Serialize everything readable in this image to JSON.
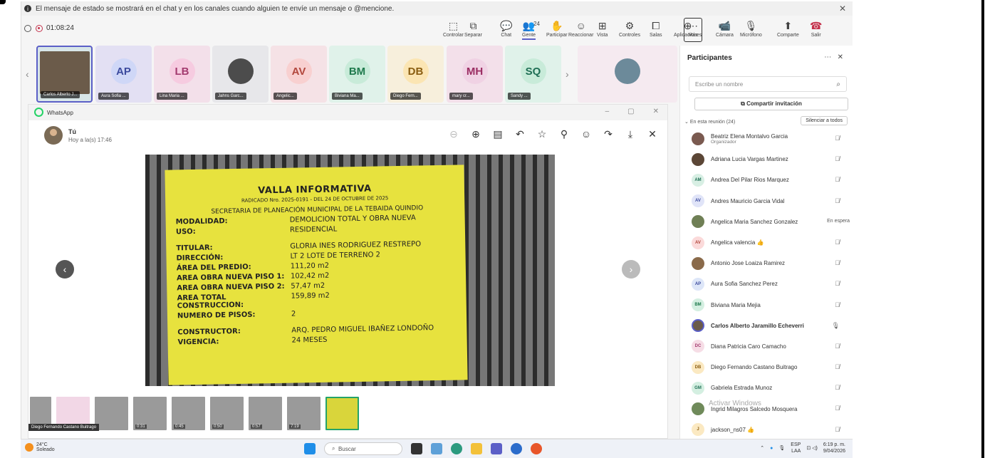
{
  "notice": {
    "text": "El mensaje de estado se mostrará en el chat y en los canales cuando alguien te envíe un mensaje o @mencione.",
    "close": "✕"
  },
  "call": {
    "timer": "01:08:24"
  },
  "toolbar": {
    "items": [
      {
        "label": "Controlar",
        "icon": "⬚"
      },
      {
        "label": "Separar",
        "icon": "⧉"
      },
      {
        "label": "Chat",
        "icon": "💬"
      },
      {
        "label": "Gente",
        "icon": "👥",
        "count": "24"
      },
      {
        "label": "Participar",
        "icon": "✋"
      },
      {
        "label": "Reaccionar",
        "icon": "☺"
      },
      {
        "label": "Vista",
        "icon": "⊞"
      },
      {
        "label": "Controles",
        "icon": "⚙"
      },
      {
        "label": "Salas",
        "icon": "⧠"
      },
      {
        "label": "Aplicaciones",
        "icon": "⊕"
      },
      {
        "label": "Más",
        "icon": "⋯"
      },
      {
        "label": "Cámara",
        "icon": "📹"
      },
      {
        "label": "Micrófono",
        "icon": "🎙"
      },
      {
        "label": "Comparte",
        "icon": "⬆"
      },
      {
        "label": "Salir",
        "icon": "☎"
      }
    ]
  },
  "strip": {
    "tiles": [
      {
        "initials": "",
        "name": "Carlos Alberto J...",
        "bg": "#d8e6e8",
        "avbg": "#6b5b4a"
      },
      {
        "initials": "AP",
        "name": "Aura Sofia ...",
        "bg": "#e3e0f3",
        "avbg": "#cfd7f7",
        "fg": "#3b4a9e"
      },
      {
        "initials": "LB",
        "name": "Lina Maria ...",
        "bg": "#f3e0ea",
        "avbg": "#f6cbe0",
        "fg": "#a33a6f"
      },
      {
        "initials": "",
        "name": "Jahns Garc...",
        "bg": "#e7e7ea",
        "avbg": "#4c4c4c"
      },
      {
        "initials": "AV",
        "name": "Angelic...",
        "bg": "#f5e2e6",
        "avbg": "#f8d0d0",
        "fg": "#b2473c"
      },
      {
        "initials": "BM",
        "name": "Biviana Ma...",
        "bg": "#e0f2ea",
        "avbg": "#c8ebd9",
        "fg": "#1f7a4d"
      },
      {
        "initials": "DB",
        "name": "Diego Fern...",
        "bg": "#f7efdc",
        "avbg": "#fbe5b3",
        "fg": "#8a5d10"
      },
      {
        "initials": "MH",
        "name": "mary cr...",
        "bg": "#f3e0ea",
        "avbg": "#f0d2e4",
        "fg": "#9b2e63"
      },
      {
        "initials": "SQ",
        "name": "Sandy ...",
        "bg": "#e0f2ea",
        "avbg": "#c8ebd9",
        "fg": "#1f6f55"
      },
      {
        "initials": "",
        "name": "",
        "bg": "#f5eaf0",
        "avbg": "#6c8a9a"
      }
    ]
  },
  "whatsapp": {
    "title": "WhatsApp",
    "sender": "Tú",
    "time": "Hoy a la(s) 17:46",
    "tools": [
      "⊖",
      "⊕",
      "▤",
      "↶",
      "☆",
      "⚲",
      "☺",
      "↷",
      "⤓",
      "✕"
    ],
    "sign": {
      "title": "VALLA INFORMATIVA",
      "radicado": "RADICADO Nro. 2025-0191 - DEL 24 DE OCTUBRE DE 2025",
      "secretaria": "SECRETARIA DE PLANEACIÓN MUNICIPAL DE LA TEBAIDA QUINDIO",
      "rows": [
        {
          "k": "MODALIDAD:",
          "v": "DEMOLICION TOTAL Y OBRA NUEVA"
        },
        {
          "k": "USO:",
          "v": "RESIDENCIAL"
        },
        {
          "k": "TITULAR:",
          "v": "GLORIA INES RODRIGUEZ RESTREPO"
        },
        {
          "k": "DIRECCIÓN:",
          "v": "LT 2 LOTE DE TERRENO 2"
        },
        {
          "k": "ÁREA DEL PREDIO:",
          "v": "111,20 m2"
        },
        {
          "k": "AREA OBRA NUEVA PISO 1:",
          "v": "102,42 m2"
        },
        {
          "k": "AREA OBRA NUEVA PISO 2:",
          "v": "57,47 m2"
        },
        {
          "k": "AREA TOTAL CONSTRUCCION:",
          "v": "159,89 m2"
        },
        {
          "k": "NUMERO DE PISOS:",
          "v": "2"
        },
        {
          "k": "CONSTRUCTOR:",
          "v": "ARQ. PEDRO MIGUEL IBAÑEZ LONDOÑO"
        },
        {
          "k": "VIGENCIA:",
          "v": "24 MESES"
        }
      ]
    },
    "thumbs": [
      "",
      "free",
      "",
      "0:31",
      "0:45",
      "0:50",
      "0:57",
      "7:19",
      ""
    ],
    "hover_tag": "Diego Fernando Castano Buitrago"
  },
  "participants": {
    "title": "Participantes",
    "search_placeholder": "Escribe un nombre",
    "invite": "Compartir invitación",
    "in_meeting": "En esta reunión (24)",
    "silence": "Silenciar a todos",
    "list": [
      {
        "initials": "",
        "name": "Beatriz Elena Montalvo Garcia",
        "sub": "Organizador",
        "avbg": "#7a5a50",
        "fg": "#fff"
      },
      {
        "initials": "",
        "name": "Adriana Lucia Vargas Martinez",
        "avbg": "#5b4636",
        "fg": "#fff"
      },
      {
        "initials": "AM",
        "name": "Andrea Del Pilar Rios Marquez",
        "avbg": "#d8efe4",
        "fg": "#1f6f55"
      },
      {
        "initials": "AV",
        "name": "Andres Mauricio Garcia Vidal",
        "avbg": "#e0e4f8",
        "fg": "#3b4a9e"
      },
      {
        "initials": "",
        "name": "Angelica Maria Sanchez Gonzalez",
        "wait": "En espera",
        "avbg": "#6f7f55",
        "fg": "#fff"
      },
      {
        "initials": "AV",
        "name": "Angelica valencia 👍",
        "avbg": "#fbdada",
        "fg": "#b2473c"
      },
      {
        "initials": "",
        "name": "Antonio Jose Loaiza Ramirez",
        "avbg": "#8a6a4a",
        "fg": "#fff"
      },
      {
        "initials": "AP",
        "name": "Aura Sofia Sanchez Perez",
        "avbg": "#dde6f8",
        "fg": "#3b4a9e"
      },
      {
        "initials": "BM",
        "name": "Biviana Maria Mejia",
        "avbg": "#d4efe1",
        "fg": "#1f7a4d"
      },
      {
        "initials": "",
        "name": "Carlos Alberto Jaramillo Echeverri",
        "avbg": "#6b5b4a",
        "fg": "#fff",
        "bold": true
      },
      {
        "initials": "DC",
        "name": "Diana Patricia Caro Camacho",
        "avbg": "#f6dde6",
        "fg": "#a33a6f"
      },
      {
        "initials": "DB",
        "name": "Diego Fernando Castano Buitrago",
        "avbg": "#fbe9c2",
        "fg": "#8a5d10"
      },
      {
        "initials": "GM",
        "name": "Gabriela Estrada Munoz",
        "avbg": "#d4efe1",
        "fg": "#1f6f55"
      },
      {
        "initials": "",
        "name": "Ingrid Milagros Salcedo Mosquera",
        "avbg": "#6f8a5a",
        "fg": "#fff"
      },
      {
        "initials": "J",
        "name": "jackson_ns07 👍",
        "avbg": "#fbe9c2",
        "fg": "#8a5d10"
      }
    ],
    "watermark": "Activar Windows"
  },
  "taskbar": {
    "temp": "24°C",
    "weather": "Soleado",
    "search": "Buscar",
    "lang": "ESP",
    "lang2": "LAA",
    "time": "6:19 p. m.",
    "date": "9/04/2026"
  }
}
